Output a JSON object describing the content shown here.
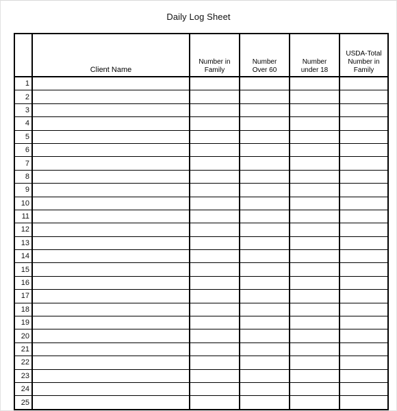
{
  "page": {
    "title": "Daily Log Sheet",
    "background_color": "#ffffff",
    "border_color": "#000000",
    "frame_color": "#e2e2e2"
  },
  "table": {
    "columns": [
      {
        "key": "row_number",
        "label": "",
        "lines": []
      },
      {
        "key": "client_name",
        "label": "Client Name",
        "lines": [
          "Client Name"
        ]
      },
      {
        "key": "number_in_family",
        "label": "Number in Family",
        "lines": [
          "Number in",
          "Family"
        ]
      },
      {
        "key": "number_over_60",
        "label": "Number Over 60",
        "lines": [
          "Number",
          "Over 60"
        ]
      },
      {
        "key": "number_under_18",
        "label": "Number under 18",
        "lines": [
          "Number",
          "under 18"
        ]
      },
      {
        "key": "usda_total_number_in_family",
        "label": "USDA-Total Number in Family",
        "lines": [
          "USDA-Total",
          "Number in",
          "Family"
        ]
      }
    ],
    "row_numbers": [
      "1",
      "2",
      "3",
      "4",
      "5",
      "6",
      "7",
      "8",
      "9",
      "10",
      "11",
      "12",
      "13",
      "14",
      "15",
      "16",
      "17",
      "18",
      "19",
      "20",
      "21",
      "22",
      "23",
      "24",
      "25"
    ],
    "rows": [
      {
        "row_number": "1",
        "client_name": "",
        "number_in_family": "",
        "number_over_60": "",
        "number_under_18": "",
        "usda_total_number_in_family": ""
      },
      {
        "row_number": "2",
        "client_name": "",
        "number_in_family": "",
        "number_over_60": "",
        "number_under_18": "",
        "usda_total_number_in_family": ""
      },
      {
        "row_number": "3",
        "client_name": "",
        "number_in_family": "",
        "number_over_60": "",
        "number_under_18": "",
        "usda_total_number_in_family": ""
      },
      {
        "row_number": "4",
        "client_name": "",
        "number_in_family": "",
        "number_over_60": "",
        "number_under_18": "",
        "usda_total_number_in_family": ""
      },
      {
        "row_number": "5",
        "client_name": "",
        "number_in_family": "",
        "number_over_60": "",
        "number_under_18": "",
        "usda_total_number_in_family": ""
      },
      {
        "row_number": "6",
        "client_name": "",
        "number_in_family": "",
        "number_over_60": "",
        "number_under_18": "",
        "usda_total_number_in_family": ""
      },
      {
        "row_number": "7",
        "client_name": "",
        "number_in_family": "",
        "number_over_60": "",
        "number_under_18": "",
        "usda_total_number_in_family": ""
      },
      {
        "row_number": "8",
        "client_name": "",
        "number_in_family": "",
        "number_over_60": "",
        "number_under_18": "",
        "usda_total_number_in_family": ""
      },
      {
        "row_number": "9",
        "client_name": "",
        "number_in_family": "",
        "number_over_60": "",
        "number_under_18": "",
        "usda_total_number_in_family": ""
      },
      {
        "row_number": "10",
        "client_name": "",
        "number_in_family": "",
        "number_over_60": "",
        "number_under_18": "",
        "usda_total_number_in_family": ""
      },
      {
        "row_number": "11",
        "client_name": "",
        "number_in_family": "",
        "number_over_60": "",
        "number_under_18": "",
        "usda_total_number_in_family": ""
      },
      {
        "row_number": "12",
        "client_name": "",
        "number_in_family": "",
        "number_over_60": "",
        "number_under_18": "",
        "usda_total_number_in_family": ""
      },
      {
        "row_number": "13",
        "client_name": "",
        "number_in_family": "",
        "number_over_60": "",
        "number_under_18": "",
        "usda_total_number_in_family": ""
      },
      {
        "row_number": "14",
        "client_name": "",
        "number_in_family": "",
        "number_over_60": "",
        "number_under_18": "",
        "usda_total_number_in_family": ""
      },
      {
        "row_number": "15",
        "client_name": "",
        "number_in_family": "",
        "number_over_60": "",
        "number_under_18": "",
        "usda_total_number_in_family": ""
      },
      {
        "row_number": "16",
        "client_name": "",
        "number_in_family": "",
        "number_over_60": "",
        "number_under_18": "",
        "usda_total_number_in_family": ""
      },
      {
        "row_number": "17",
        "client_name": "",
        "number_in_family": "",
        "number_over_60": "",
        "number_under_18": "",
        "usda_total_number_in_family": ""
      },
      {
        "row_number": "18",
        "client_name": "",
        "number_in_family": "",
        "number_over_60": "",
        "number_under_18": "",
        "usda_total_number_in_family": ""
      },
      {
        "row_number": "19",
        "client_name": "",
        "number_in_family": "",
        "number_over_60": "",
        "number_under_18": "",
        "usda_total_number_in_family": ""
      },
      {
        "row_number": "20",
        "client_name": "",
        "number_in_family": "",
        "number_over_60": "",
        "number_under_18": "",
        "usda_total_number_in_family": ""
      },
      {
        "row_number": "21",
        "client_name": "",
        "number_in_family": "",
        "number_over_60": "",
        "number_under_18": "",
        "usda_total_number_in_family": ""
      },
      {
        "row_number": "22",
        "client_name": "",
        "number_in_family": "",
        "number_over_60": "",
        "number_under_18": "",
        "usda_total_number_in_family": ""
      },
      {
        "row_number": "23",
        "client_name": "",
        "number_in_family": "",
        "number_over_60": "",
        "number_under_18": "",
        "usda_total_number_in_family": ""
      },
      {
        "row_number": "24",
        "client_name": "",
        "number_in_family": "",
        "number_over_60": "",
        "number_under_18": "",
        "usda_total_number_in_family": ""
      },
      {
        "row_number": "25",
        "client_name": "",
        "number_in_family": "",
        "number_over_60": "",
        "number_under_18": "",
        "usda_total_number_in_family": ""
      }
    ]
  }
}
